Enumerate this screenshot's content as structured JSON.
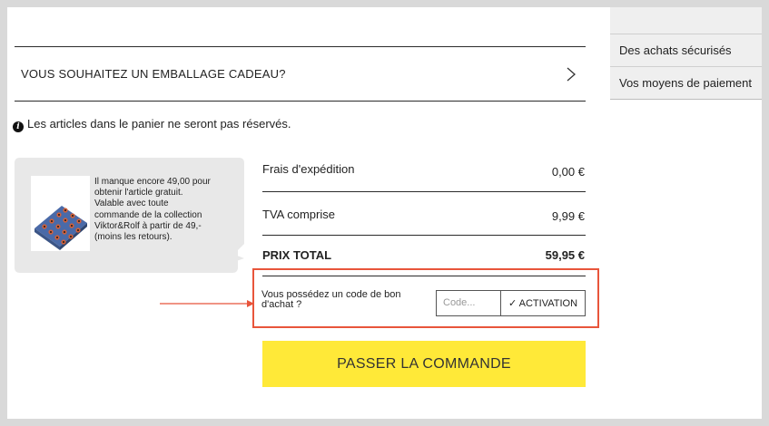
{
  "sidebar": {
    "items": [
      {
        "label": ""
      },
      {
        "label": "Des achats sécurisés"
      },
      {
        "label": "Vos moyens de paiement"
      }
    ]
  },
  "gift_wrap": {
    "label": "VOUS SOUHAITEZ UN EMBALLAGE CADEAU?"
  },
  "notice": {
    "text": "Les articles dans le panier ne seront pas réservés."
  },
  "promo": {
    "text": "Il manque encore 49,00 pour obtenir l'article gratuit. Valable avec toute commande de la collection Viktor&Rolf à partir de 49,- (moins les retours)."
  },
  "summary": {
    "shipping_label": "Frais d'expédition",
    "shipping_value": "0,00 €",
    "vat_label": "TVA comprise",
    "vat_value": "9,99 €",
    "total_label": "PRIX TOTAL",
    "total_value": "59,95 €"
  },
  "voucher": {
    "label": "Vous possédez un code de bon d'achat ?",
    "placeholder": "Code...",
    "button_label": "ACTIVATION"
  },
  "checkout": {
    "label": "PASSER LA COMMANDE"
  },
  "colors": {
    "accent_yellow": "#ffe938",
    "highlight_red": "#e8553b",
    "sidebar_bg": "#efefef"
  }
}
